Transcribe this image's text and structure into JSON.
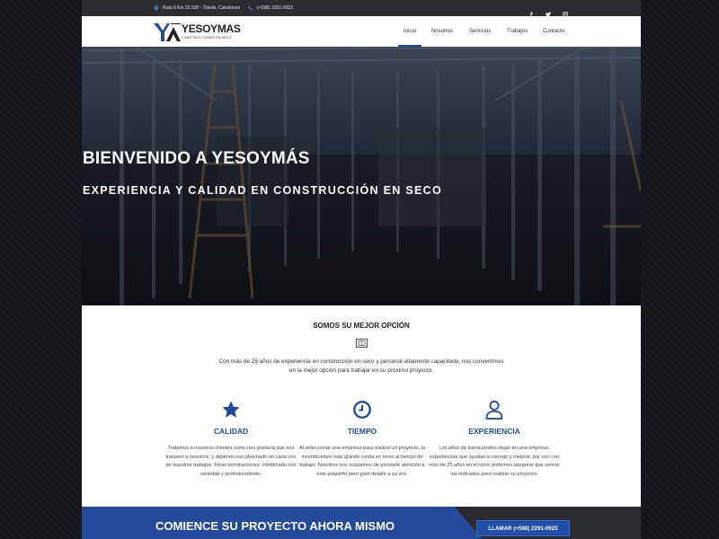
{
  "topbar": {
    "address": "Ruta 6 Km 22.500 - Toledo, Canelones",
    "phone": "(+598) 2291-0923",
    "social": [
      "facebook-icon",
      "twitter-icon",
      "instagram-icon"
    ]
  },
  "brand": {
    "name": "YESOYMAS",
    "tagline": "CONSTRUCCIONES EN SECO"
  },
  "nav": {
    "items": [
      {
        "label": "Inicio",
        "active": true
      },
      {
        "label": "Nosotros",
        "active": false
      },
      {
        "label": "Servicios",
        "active": false
      },
      {
        "label": "Trabajos",
        "active": false
      },
      {
        "label": "Contacto",
        "active": false
      }
    ]
  },
  "hero": {
    "title": "BIENVENIDO A YESOYMÁS",
    "subtitle": "EXPERIENCIA Y CALIDAD EN CONSTRUCCIÓN EN SECO"
  },
  "best": {
    "title": "SOMOS SU MEJOR OPCIÓN",
    "line1": "Con más de 25 años de experiencia en construcción en seco y personal altamente capacitado, nos convertimos",
    "line2": "en la mejor opción para trabajar en su proximo proyecto."
  },
  "features": [
    {
      "icon": "star-icon",
      "title": "CALIDAD",
      "text": "Tratamos a nuestros clientes como nos gustaría que nos tratasen a nosotros, y dejamos eso plasmado en cada uno de nuestros trabajos. Finas terminaciones, combinado con seriedad y profesionalismo."
    },
    {
      "icon": "clock-icon",
      "title": "TIEMPO",
      "text": "Al seleccionar una empresa para realizar un proyecto, la incertidumbre más grande ronda en torno al tiempo de trabajo. Nosotros nos ocupamos de prestarle atención a este pequeño pero gran detalle a su vez."
    },
    {
      "icon": "user-icon",
      "title": "EXPERIENCIA",
      "text": "Los años de transcurridos dejan en una empresa, experiencias que ayudan a corregir y mejorar, por eso con más de 25 años en el rubro podemos asegurar que somos los indicados para realizar su proyecto."
    }
  ],
  "cta": {
    "title": "COMIENCE SU PROYECTO AHORA MISMO",
    "button": "LLAMAR (+598) 2291-0923"
  },
  "colors": {
    "accent": "#244b9a",
    "topbar": "#2c2d31",
    "page_bg": "#14151b"
  }
}
